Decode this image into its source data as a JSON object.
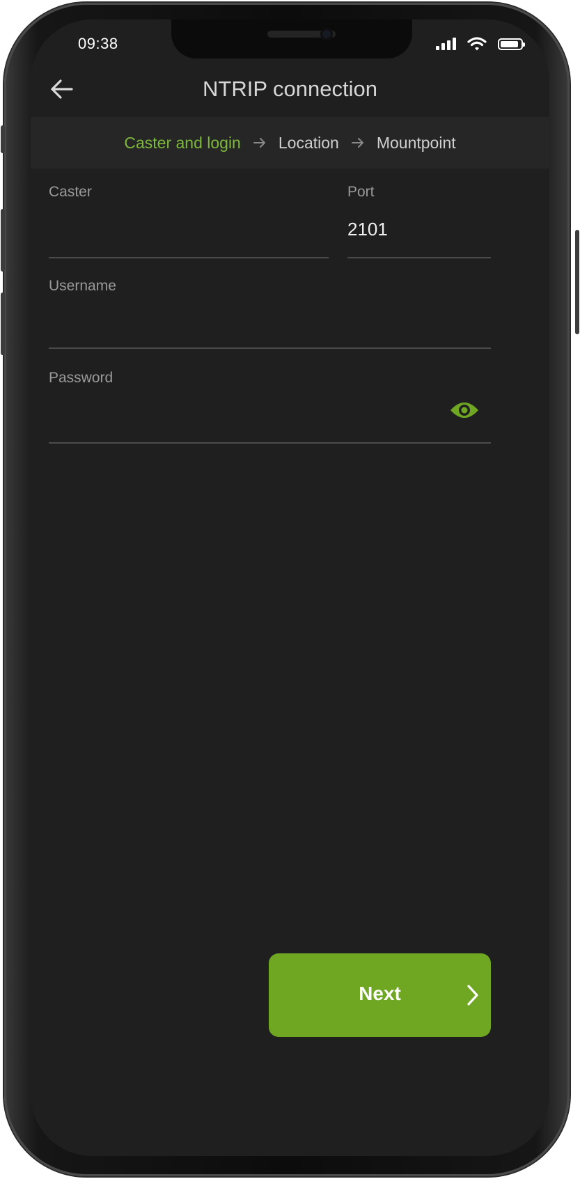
{
  "status_bar": {
    "time": "09:38",
    "battery_level": 0.9,
    "signal_bars": 4
  },
  "header": {
    "title": "NTRIP connection"
  },
  "stepper": {
    "steps": [
      {
        "label": "Caster and login",
        "active": true
      },
      {
        "label": "Location",
        "active": false
      },
      {
        "label": "Mountpoint",
        "active": false
      }
    ]
  },
  "form": {
    "caster": {
      "label": "Caster",
      "value": ""
    },
    "port": {
      "label": "Port",
      "value": "2101"
    },
    "username": {
      "label": "Username",
      "value": ""
    },
    "password": {
      "label": "Password",
      "value": ""
    }
  },
  "actions": {
    "next_label": "Next"
  },
  "colors": {
    "accent": "#7db93a",
    "button": "#6fa723",
    "background": "#1f1f1f"
  },
  "icons": {
    "back": "arrow-left-icon",
    "step_separator": "arrow-right-icon",
    "password_toggle": "eye-icon",
    "next": "chevron-right-icon"
  }
}
